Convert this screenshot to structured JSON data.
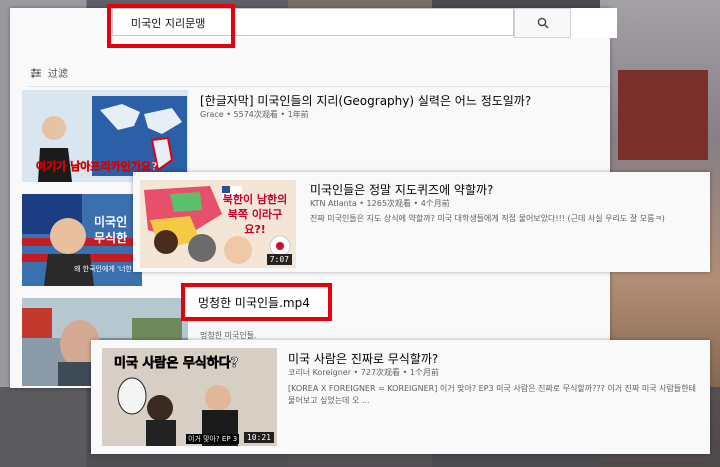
{
  "search": {
    "query": "미국인 지리문맹"
  },
  "filter": {
    "label": "过滤"
  },
  "videos": [
    {
      "title": "[한글자막] 미국인들의 지리(Geography) 실력은 어느 정도일까?",
      "meta": "Grace • 5574次观看 • 1年前",
      "thumb_caption": "여기가 남아프리카인가요?"
    },
    {
      "title": "미국인들은 정말 지도퀴즈에 약할까?",
      "meta": "KTN Atlanta • 1265次观看 • 4个月前",
      "desc": "진짜 미국인들은 지도 상식에 약할까? 미국 대학생들에게 직접 물어보았다!!! (근데 사실 우리도 잘 모름ㅋ)",
      "thumb_caption": "북한이 남한의 북쪽 이라구요?!",
      "duration": "7:07"
    },
    {
      "title": "멍청한 미국인들.mp4",
      "meta": "멍청한 미국인들.",
      "side_thumb_caption": "미국인 무식한",
      "side_thumb_sub": "왜 한국인에게 '너한"
    },
    {
      "title": "미국 사람은 진짜로 무식할까?",
      "meta": "코리너 Koreigner • 727次观看 • 1个月前",
      "desc": "[KOREA X FOREIGNER = KOREIGNER] 이거 맞아? EP3 미국 사람은 진짜로 무식할까??? 이거 진짜 미국 사람들한테 물어보고 싶었는데 오 ...",
      "thumb_caption": "미국 사람은 무식하다?",
      "thumb_sub": "이거 맞아? EP 3",
      "duration": "10:21"
    }
  ],
  "colors": {
    "highlight": "#e3000f",
    "panel": "#f9f9f9"
  }
}
